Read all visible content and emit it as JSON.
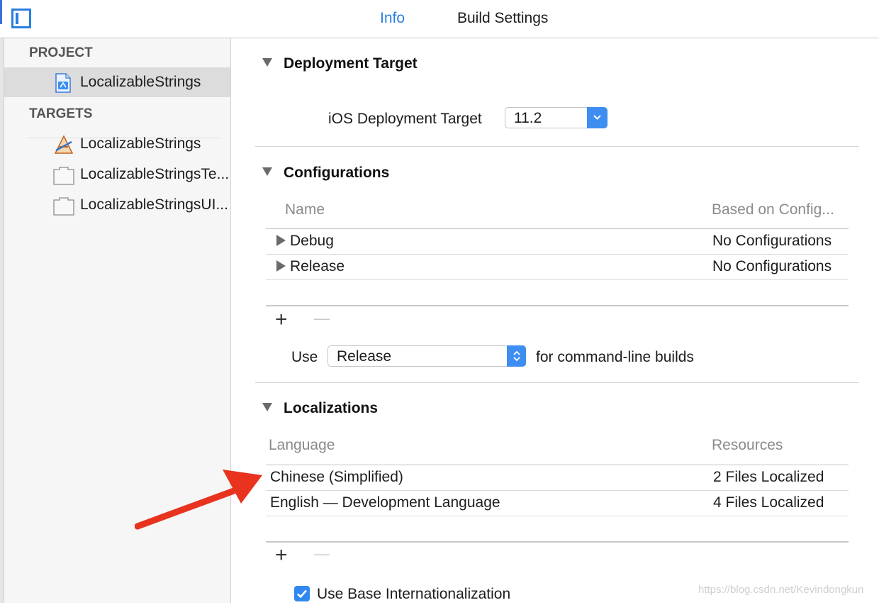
{
  "tabs": [
    {
      "label": "Info"
    },
    {
      "label": "Build Settings"
    }
  ],
  "sidebar": {
    "project_header": "PROJECT",
    "project_item": "LocalizableStrings",
    "targets_header": "TARGETS",
    "targets": [
      {
        "label": "LocalizableStrings",
        "icon": "app-target-icon"
      },
      {
        "label": "LocalizableStringsTe...",
        "icon": "test-bundle-icon"
      },
      {
        "label": "LocalizableStringsUI...",
        "icon": "test-bundle-icon"
      }
    ]
  },
  "deployment": {
    "title": "Deployment Target",
    "ios_label": "iOS Deployment Target",
    "ios_value": "11.2"
  },
  "configurations": {
    "title": "Configurations",
    "col_name": "Name",
    "col_based": "Based on Config...",
    "rows": [
      {
        "name": "Debug",
        "based": "No Configurations"
      },
      {
        "name": "Release",
        "based": "No Configurations"
      }
    ],
    "add": "+",
    "remove": "—",
    "use_label": "Use",
    "use_value": "Release",
    "use_suffix": "for command-line builds"
  },
  "localizations": {
    "title": "Localizations",
    "col_language": "Language",
    "col_resources": "Resources",
    "rows": [
      {
        "language": "Chinese (Simplified)",
        "resources": "2 Files Localized"
      },
      {
        "language": "English — Development Language",
        "resources": "4 Files Localized"
      }
    ],
    "add": "+",
    "remove": "—",
    "base_i18n_label": "Use Base Internationalization",
    "base_i18n_checked": true
  },
  "watermark": "https://blog.csdn.net/Kevindongkun",
  "colors": {
    "accent": "#2a7fe0",
    "popup": "#3d8ef0",
    "annotation": "#e8331f"
  }
}
